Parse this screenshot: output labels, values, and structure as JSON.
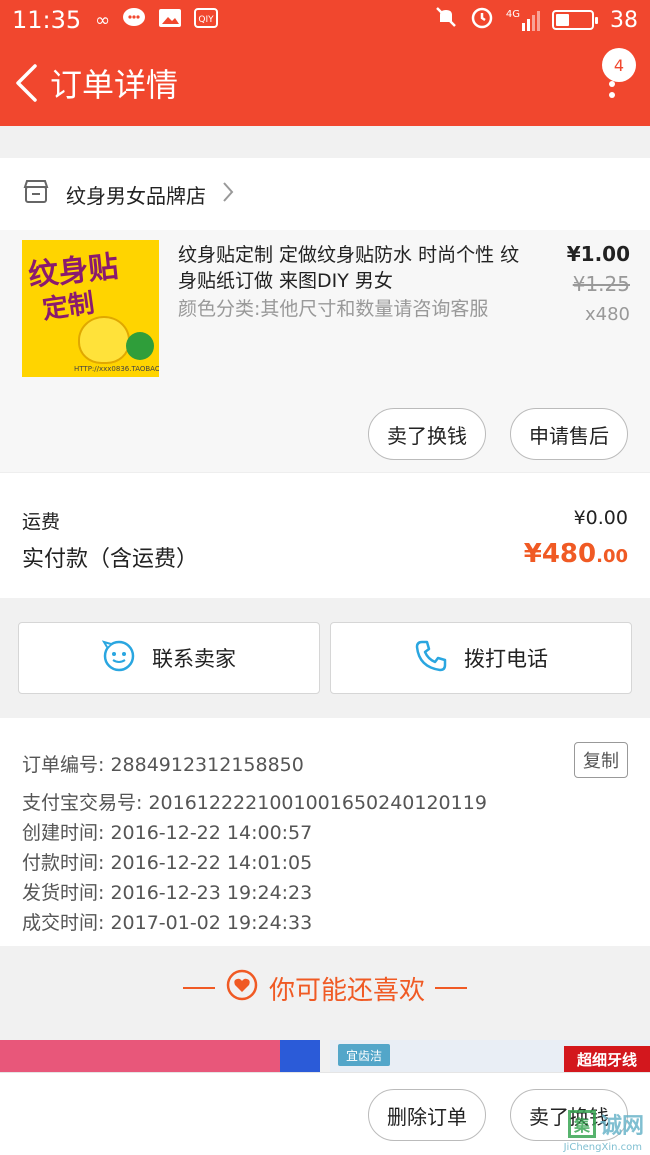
{
  "status_bar": {
    "time": "11:35",
    "battery": "38",
    "network": "4G",
    "icons": [
      "infinity-icon",
      "chat-icon",
      "photo-icon",
      "iqiyi-icon",
      "mute-icon",
      "alarm-icon",
      "signal-icon",
      "battery-icon"
    ],
    "battery_level": 0.38
  },
  "navbar": {
    "title": "订单详情",
    "badge": "4"
  },
  "store": {
    "name": "纹身男女品牌店"
  },
  "product": {
    "image_text_1": "纹身贴",
    "image_text_2": "定制",
    "image_url_text": "HTTP://xxx0836.TAOBAO.COM",
    "title": "纹身贴定制 定做纹身贴防水 时尚个性 纹身贴纸订做 来图DIY 男女",
    "spec": "颜色分类:其他尺寸和数量请咨询客服",
    "price": "¥1.00",
    "original_price": "¥1.25",
    "quantity": "x480",
    "btn_sell": "卖了换钱",
    "btn_aftersale": "申请售后"
  },
  "fee": {
    "shipping_label": "运费",
    "shipping_value": "¥0.00",
    "paid_label": "实付款（含运费）",
    "paid_main": "¥480",
    "paid_decimal": ".00"
  },
  "contact": {
    "seller_label": "联系卖家",
    "phone_label": "拨打电话"
  },
  "order_info": {
    "order_no": "订单编号: 2884912312158850",
    "copy_label": "复制",
    "alipay_no": "支付宝交易号: 2016122221001001650240120119",
    "created": "创建时间: 2016-12-22 14:00:57",
    "paid": "付款时间: 2016-12-22 14:01:05",
    "shipped": "发货时间: 2016-12-23 19:24:23",
    "completed": "成交时间: 2017-01-02 19:24:33"
  },
  "recommend": {
    "title": "你可能还喜欢",
    "item2_tag": "宜齿洁",
    "item2_badge": "超细牙线"
  },
  "bottom": {
    "delete_label": "删除订单",
    "sell_label": "卖了换钱"
  },
  "watermark": {
    "char": "集",
    "text": "诚网",
    "domain": "JiChengXin.com"
  },
  "colors": {
    "brand": "#f1472e",
    "price_accent": "#f05a24"
  }
}
